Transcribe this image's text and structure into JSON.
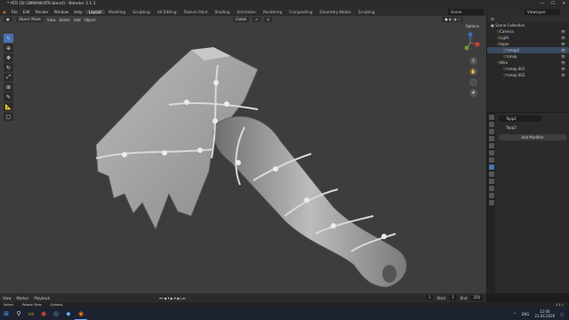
{
  "window": {
    "title": "* ATR [D:\\ЗИМАФ\\ATR.blend] - Blender 3.1.1",
    "controls": [
      "—",
      "☐",
      "✕"
    ]
  },
  "menu": [
    "File",
    "Edit",
    "Render",
    "Window",
    "Help"
  ],
  "workspaces": [
    {
      "label": "Layout",
      "active": true
    },
    {
      "label": "Modeling"
    },
    {
      "label": "Sculpting"
    },
    {
      "label": "UV Editing"
    },
    {
      "label": "Texture Paint"
    },
    {
      "label": "Shading"
    },
    {
      "label": "Animation"
    },
    {
      "label": "Rendering"
    },
    {
      "label": "Compositing"
    },
    {
      "label": "Geometry Nodes"
    },
    {
      "label": "Scripting"
    }
  ],
  "scene": "Scene",
  "view_layer": "ViewLayer",
  "viewport": {
    "mode": "Object Mode",
    "menus": [
      "View",
      "Select",
      "Add",
      "Object"
    ],
    "orientation": "Global",
    "options": "Options",
    "gizmo_axes": [
      "X",
      "Y",
      "Z"
    ]
  },
  "outliner": {
    "title": "Scene Collection",
    "rows": [
      {
        "label": "Camera",
        "depth": 1,
        "selected": false
      },
      {
        "label": "Light",
        "depth": 1,
        "selected": false
      },
      {
        "label": "topor",
        "depth": 1,
        "selected": false
      },
      {
        "label": "топор2",
        "depth": 2,
        "selected": true
      },
      {
        "label": "топор",
        "depth": 2,
        "selected": false
      },
      {
        "label": "Wire",
        "depth": 1,
        "selected": false
      },
      {
        "label": "топор.001",
        "depth": 2,
        "selected": false
      },
      {
        "label": "топор.002",
        "depth": 2,
        "selected": false
      }
    ]
  },
  "properties": {
    "object_name": "Topp2",
    "breadcrumb": "Topp2",
    "add_modifier": "Add Modifier"
  },
  "timeline": {
    "items": [
      "View",
      "Marker",
      "Playback"
    ],
    "current_frame": "1",
    "start_label": "Start",
    "start": "1",
    "end_label": "End",
    "end": "250"
  },
  "status": {
    "items": [
      "Select",
      "Rotate View",
      "Options"
    ],
    "version": "3.1.1"
  },
  "taskbar": {
    "lang": "ENG",
    "time": "12:06",
    "date": "21.04.2026"
  }
}
